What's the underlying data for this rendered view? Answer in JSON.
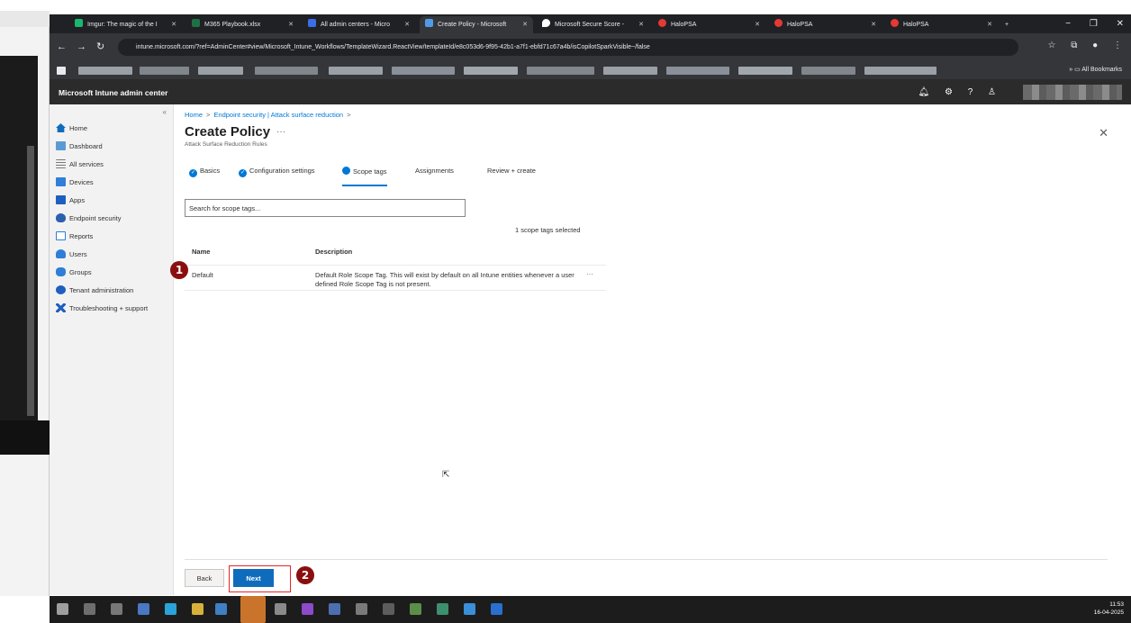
{
  "browser": {
    "tabs": [
      {
        "title": "Imgur: The magic of the I"
      },
      {
        "title": "M365 Playbook.xlsx"
      },
      {
        "title": "All admin centers - Micro"
      },
      {
        "title": "Create Policy - Microsoft"
      },
      {
        "title": "Microsoft Secure Score -"
      },
      {
        "title": "HaloPSA"
      },
      {
        "title": "HaloPSA"
      },
      {
        "title": "HaloPSA"
      }
    ],
    "url": "intune.microsoft.com/?ref=AdminCenter#view/Microsoft_Intune_Workflows/TemplateWizard.ReactView/templateId/e8c053d6-9f95-42b1-a7f1-ebfd71c67a4b/isCopilotSparkVisible~/false",
    "all_bookmarks_label": "All Bookmarks"
  },
  "app": {
    "title": "Microsoft Intune admin center"
  },
  "sidebar": {
    "items": [
      {
        "label": "Home",
        "icon": "home-icon"
      },
      {
        "label": "Dashboard",
        "icon": "dashboard-icon"
      },
      {
        "label": "All services",
        "icon": "list-icon"
      },
      {
        "label": "Devices",
        "icon": "devices-icon"
      },
      {
        "label": "Apps",
        "icon": "apps-icon"
      },
      {
        "label": "Endpoint security",
        "icon": "shield-icon"
      },
      {
        "label": "Reports",
        "icon": "reports-icon"
      },
      {
        "label": "Users",
        "icon": "user-icon"
      },
      {
        "label": "Groups",
        "icon": "groups-icon"
      },
      {
        "label": "Tenant administration",
        "icon": "tenant-icon"
      },
      {
        "label": "Troubleshooting + support",
        "icon": "tools-icon"
      }
    ]
  },
  "main": {
    "breadcrumb": [
      "Home",
      "Endpoint security | Attack surface reduction"
    ],
    "title": "Create Policy",
    "subtitle": "Attack Surface Reduction Rules",
    "steps": [
      {
        "label": "Basics",
        "state": "done"
      },
      {
        "label": "Configuration settings",
        "state": "done"
      },
      {
        "label": "Scope tags",
        "state": "active"
      },
      {
        "label": "Assignments",
        "state": "pending"
      },
      {
        "label": "Review + create",
        "state": "pending"
      }
    ],
    "search_placeholder": "Search for scope tags...",
    "selected_count": "1 scope tags selected",
    "table": {
      "columns": [
        "Name",
        "Description"
      ],
      "rows": [
        {
          "name": "Default",
          "description": "Default Role Scope Tag. This will exist by default on all Intune entities whenever a user defined Role Scope Tag is not present."
        }
      ]
    },
    "back_label": "Back",
    "next_label": "Next"
  },
  "annotations": {
    "marker1": "1",
    "marker2": "2"
  },
  "taskbar": {
    "time": "11:53",
    "date": "16-04-2025"
  },
  "colors": {
    "accent": "#0078d4",
    "primary_button": "#0f6cbd",
    "highlight_box": "#e3262b",
    "marker": "#8b0e0e",
    "header_bg": "#2b2b2b"
  }
}
